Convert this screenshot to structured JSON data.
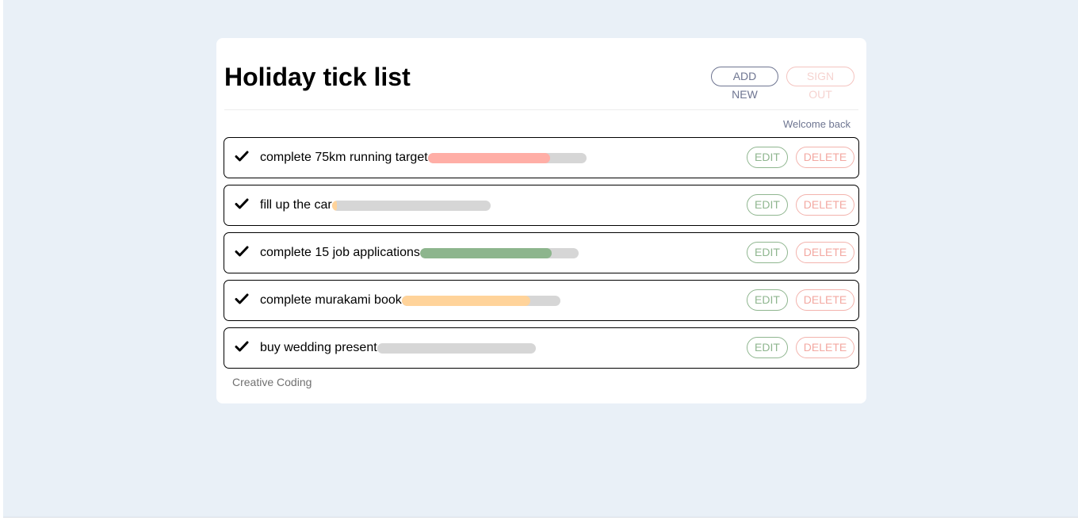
{
  "header": {
    "title": "Holiday tick list",
    "add_new_label": "ADD NEW",
    "sign_out_label": "SIGN OUT"
  },
  "welcome_text": "Welcome back",
  "items": [
    {
      "label": "complete 75km running target",
      "progress": 0.77,
      "bar_color": "#ffaea6",
      "edit_label": "EDIT",
      "delete_label": "DELETE",
      "icon": "check-icon"
    },
    {
      "label": "fill up the car",
      "progress": 0.03,
      "bar_color": "#ffd39a",
      "edit_label": "EDIT",
      "delete_label": "DELETE",
      "icon": "check-icon"
    },
    {
      "label": "complete 15 job applications",
      "progress": 0.83,
      "bar_color": "#8db58d",
      "edit_label": "EDIT",
      "delete_label": "DELETE",
      "icon": "check-icon"
    },
    {
      "label": "complete murakami book",
      "progress": 0.81,
      "bar_color": "#ffd39a",
      "edit_label": "EDIT",
      "delete_label": "DELETE",
      "icon": "check-icon"
    },
    {
      "label": "buy wedding present",
      "progress": 0.0,
      "bar_color": "#d6d6d6",
      "edit_label": "EDIT",
      "delete_label": "DELETE",
      "icon": "check-icon"
    }
  ],
  "footer_text": "Creative Coding",
  "colors": {
    "page_background": "#e9f0f7",
    "add_new_accent": "#6e7591",
    "edit_accent": "#8fb68f",
    "delete_accent": "#f3a9a2",
    "bar_track": "#d6d6d6"
  }
}
